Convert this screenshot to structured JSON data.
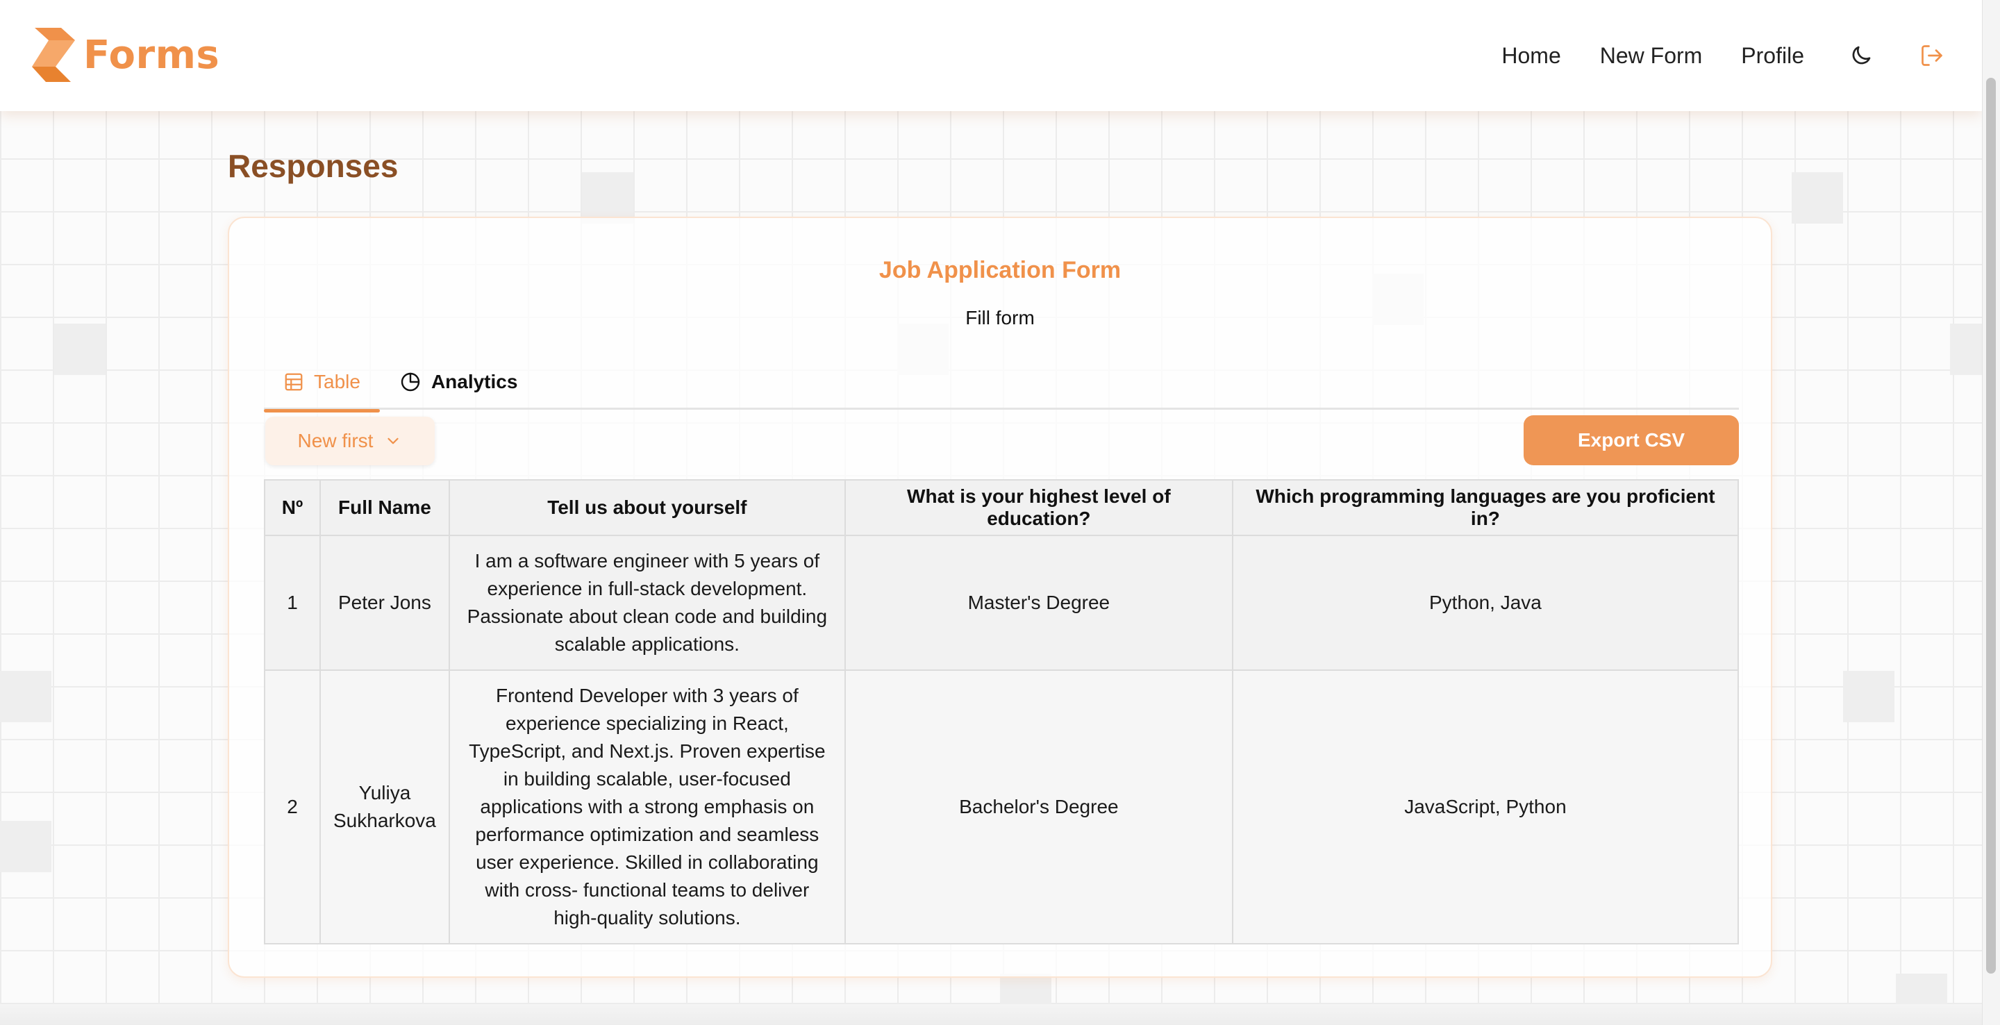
{
  "brand": {
    "name": "Forms",
    "accent": "#f0914a"
  },
  "nav": {
    "home": "Home",
    "new_form": "New Form",
    "profile": "Profile",
    "theme_icon": "moon-icon",
    "logout_icon": "logout-icon"
  },
  "page": {
    "title": "Responses"
  },
  "form": {
    "title": "Job Application Form",
    "subtitle": "Fill form"
  },
  "tabs": [
    {
      "label": "Table",
      "icon": "table-icon",
      "active": true
    },
    {
      "label": "Analytics",
      "icon": "pie-chart-icon",
      "active": false
    }
  ],
  "sort": {
    "label": "New first",
    "icon": "chevron-down-icon"
  },
  "export": {
    "label": "Export CSV"
  },
  "table": {
    "columns": [
      "Nº",
      "Full Name",
      "Tell us about yourself",
      "What is your highest level of education?",
      "Which programming languages are you proficient in?"
    ],
    "rows": [
      {
        "num": "1",
        "name": "Peter Jons",
        "about": "I am a software engineer with 5 years of experience in full-stack development. Passionate about clean code and building scalable applications.",
        "education": "Master's Degree",
        "languages": "Python, Java"
      },
      {
        "num": "2",
        "name": "Yuliya Sukharkova",
        "about": "Frontend Developer with 3 years of experience specializing in React, TypeScript, and Next.js. Proven expertise in building scalable, user-focused applications with a strong emphasis on performance optimization and seamless user experience. Skilled in collaborating with cross- functional teams to deliver high-quality solutions.",
        "education": "Bachelor's Degree",
        "languages": "JavaScript, Python"
      }
    ]
  }
}
